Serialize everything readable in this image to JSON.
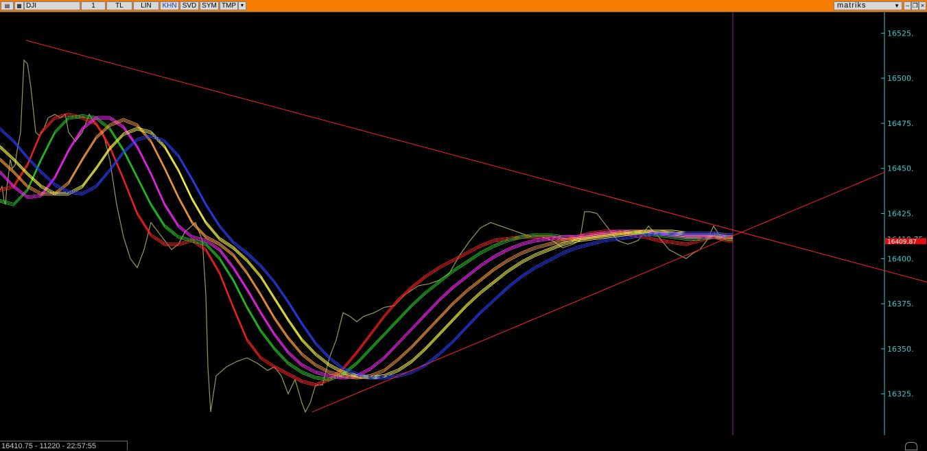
{
  "toolbar": {
    "symbol": "DJI",
    "period": "1",
    "buttons": [
      "TL",
      "LIN",
      "KHN",
      "SVD",
      "SYM",
      "TMP"
    ],
    "active_button": "KHN",
    "dropdown_icon": "triangle-down-icon",
    "brand": "matriks",
    "window_icons": [
      "minimize-icon",
      "restore-icon",
      "close-icon"
    ]
  },
  "colors": {
    "toolbar_bg": "#f57c00",
    "background": "#000000",
    "price": "#9a9a5a",
    "axis_labels": "#3ec8c8",
    "trendline": "#ff2020",
    "current_price_tag": "#e01010"
  },
  "chart_data": {
    "type": "line",
    "symbol": "DJI",
    "y_ticks": [
      16525,
      16500,
      16475,
      16450,
      16425,
      16400,
      16375,
      16350,
      16325
    ],
    "ylim": [
      16304,
      16535
    ],
    "last_price_label": "16410.75",
    "indicator_label": "16409.87",
    "series": [
      {
        "color": "#9a9a5a",
        "x": [
          0,
          3,
          6,
          8,
          10,
          12,
          15,
          18,
          22,
          25,
          30,
          35,
          40,
          45,
          52,
          58,
          64,
          70,
          80,
          88,
          95,
          100,
          110,
          120,
          130,
          140,
          150,
          160,
          170,
          180,
          190,
          200,
          210,
          220,
          230,
          240,
          250,
          260,
          270,
          285,
          295,
          300,
          303,
          307,
          315,
          330,
          345,
          360,
          375,
          390,
          400,
          410,
          420,
          430,
          440,
          445,
          452,
          460,
          470,
          480,
          490,
          500,
          510,
          520,
          530,
          545,
          560,
          575,
          590,
          610,
          625,
          640,
          655,
          670,
          685,
          700,
          715,
          730,
          745,
          760,
          775,
          790,
          805,
          820,
          835,
          845,
          852,
          860,
          870,
          880,
          890,
          900,
          915,
          930,
          945,
          960,
          975,
          990,
          1000,
          1010,
          1020,
          1030,
          1040,
          1050,
          1060,
          1068
        ],
        "y": [
          16438,
          16440,
          16432,
          16430,
          16440,
          16445,
          16455,
          16450,
          16452,
          16460,
          16470,
          16510,
          16508,
          16495,
          16470,
          16468,
          16472,
          16478,
          16480,
          16478,
          16480,
          16470,
          16465,
          16470,
          16480,
          16474,
          16470,
          16455,
          16430,
          16412,
          16400,
          16395,
          16405,
          16420,
          16415,
          16410,
          16405,
          16408,
          16415,
          16420,
          16410,
          16380,
          16340,
          16315,
          16335,
          16340,
          16343,
          16345,
          16342,
          16338,
          16340,
          16335,
          16325,
          16333,
          16320,
          16315,
          16320,
          16330,
          16330,
          16345,
          16355,
          16370,
          16368,
          16365,
          16368,
          16370,
          16373,
          16374,
          16380,
          16385,
          16386,
          16388,
          16392,
          16402,
          16410,
          16417,
          16420,
          16418,
          16416,
          16414,
          16412,
          16412,
          16410,
          16406,
          16408,
          16410,
          16426,
          16426,
          16425,
          16420,
          16415,
          16410,
          16408,
          16410,
          16418,
          16412,
          16405,
          16402,
          16400,
          16403,
          16405,
          16410,
          16418,
          16412,
          16410,
          16410
        ]
      },
      {
        "color": "#ff2020",
        "x": [
          0,
          20,
          40,
          60,
          80,
          100,
          120,
          140,
          160,
          180,
          200,
          220,
          240,
          260,
          280,
          300,
          320,
          340,
          360,
          380,
          400,
          420,
          440,
          460,
          480,
          500,
          520,
          540,
          560,
          580,
          600,
          620,
          640,
          660,
          680,
          700,
          720,
          740,
          760,
          780,
          800,
          820,
          840,
          860,
          880,
          900,
          920,
          940,
          960,
          980,
          1000,
          1020,
          1040,
          1060,
          1068
        ],
        "y": [
          16438,
          16440,
          16452,
          16470,
          16478,
          16480,
          16478,
          16475,
          16462,
          16444,
          16425,
          16413,
          16408,
          16408,
          16410,
          16405,
          16392,
          16373,
          16355,
          16345,
          16340,
          16336,
          16332,
          16330,
          16333,
          16339,
          16348,
          16358,
          16368,
          16377,
          16384,
          16390,
          16395,
          16399,
          16403,
          16407,
          16410,
          16411,
          16412,
          16412,
          16412,
          16411,
          16412,
          16414,
          16415,
          16415,
          16413,
          16412,
          16410,
          16409,
          16408,
          16410,
          16412,
          16410,
          16410
        ]
      },
      {
        "color": "#22cc22",
        "x": [
          0,
          20,
          40,
          60,
          80,
          100,
          120,
          140,
          160,
          180,
          200,
          220,
          240,
          260,
          280,
          300,
          320,
          340,
          360,
          380,
          400,
          420,
          440,
          460,
          480,
          500,
          520,
          540,
          560,
          580,
          600,
          620,
          640,
          660,
          680,
          700,
          720,
          740,
          760,
          780,
          800,
          820,
          840,
          860,
          880,
          900,
          920,
          940,
          960,
          980,
          1000,
          1020,
          1040,
          1060,
          1068
        ],
        "y": [
          16432,
          16430,
          16438,
          16455,
          16470,
          16478,
          16479,
          16478,
          16472,
          16460,
          16445,
          16430,
          16418,
          16412,
          16410,
          16408,
          16400,
          16388,
          16373,
          16360,
          16350,
          16342,
          16337,
          16334,
          16333,
          16336,
          16342,
          16350,
          16358,
          16366,
          16374,
          16381,
          16387,
          16393,
          16398,
          16403,
          16407,
          16410,
          16412,
          16413,
          16413,
          16412,
          16412,
          16413,
          16414,
          16415,
          16415,
          16414,
          16413,
          16412,
          16411,
          16411,
          16412,
          16411,
          16411
        ]
      },
      {
        "color": "#ff22ff",
        "x": [
          0,
          20,
          40,
          60,
          80,
          100,
          120,
          140,
          160,
          180,
          200,
          220,
          240,
          260,
          280,
          300,
          320,
          340,
          360,
          380,
          400,
          420,
          440,
          460,
          480,
          500,
          520,
          540,
          560,
          580,
          600,
          620,
          640,
          660,
          680,
          700,
          720,
          740,
          760,
          780,
          800,
          820,
          840,
          860,
          880,
          900,
          920,
          940,
          960,
          980,
          1000,
          1020,
          1040,
          1060,
          1068
        ],
        "y": [
          16448,
          16440,
          16434,
          16435,
          16445,
          16460,
          16472,
          16478,
          16478,
          16473,
          16462,
          16447,
          16430,
          16418,
          16412,
          16410,
          16405,
          16395,
          16383,
          16370,
          16358,
          16348,
          16341,
          16337,
          16335,
          16334,
          16335,
          16339,
          16345,
          16353,
          16361,
          16369,
          16377,
          16384,
          16390,
          16396,
          16401,
          16405,
          16408,
          16410,
          16411,
          16412,
          16412,
          16413,
          16414,
          16415,
          16415,
          16415,
          16414,
          16413,
          16412,
          16412,
          16412,
          16412,
          16412
        ]
      },
      {
        "color": "#ffa040",
        "x": [
          0,
          20,
          40,
          60,
          80,
          100,
          120,
          140,
          160,
          180,
          200,
          220,
          240,
          260,
          280,
          300,
          320,
          340,
          360,
          380,
          400,
          420,
          440,
          460,
          480,
          500,
          520,
          540,
          560,
          580,
          600,
          620,
          640,
          660,
          680,
          700,
          720,
          740,
          760,
          780,
          800,
          820,
          840,
          860,
          880,
          900,
          920,
          940,
          960,
          980,
          1000,
          1020,
          1040,
          1060,
          1068
        ],
        "y": [
          16455,
          16448,
          16440,
          16436,
          16436,
          16442,
          16455,
          16467,
          16474,
          16477,
          16474,
          16465,
          16450,
          16434,
          16420,
          16412,
          16408,
          16402,
          16392,
          16380,
          16367,
          16356,
          16347,
          16341,
          16337,
          16335,
          16334,
          16335,
          16338,
          16344,
          16351,
          16359,
          16367,
          16375,
          16382,
          16388,
          16394,
          16399,
          16403,
          16406,
          16408,
          16410,
          16411,
          16412,
          16413,
          16414,
          16415,
          16415,
          16415,
          16414,
          16413,
          16413,
          16413,
          16412,
          16412
        ]
      },
      {
        "color": "#ffff40",
        "x": [
          0,
          20,
          40,
          60,
          80,
          100,
          120,
          140,
          160,
          180,
          200,
          220,
          240,
          260,
          280,
          300,
          320,
          340,
          360,
          380,
          400,
          420,
          440,
          460,
          480,
          500,
          520,
          540,
          560,
          580,
          600,
          620,
          640,
          660,
          680,
          700,
          720,
          740,
          760,
          780,
          800,
          820,
          840,
          860,
          880,
          900,
          920,
          940,
          960,
          980,
          1000,
          1020,
          1040,
          1060,
          1068
        ],
        "y": [
          16462,
          16455,
          16447,
          16440,
          16436,
          16436,
          16440,
          16450,
          16461,
          16469,
          16472,
          16470,
          16462,
          16449,
          16433,
          16420,
          16411,
          16406,
          16399,
          16390,
          16378,
          16366,
          16355,
          16347,
          16341,
          16337,
          16335,
          16334,
          16335,
          16338,
          16343,
          16350,
          16358,
          16366,
          16374,
          16381,
          16387,
          16393,
          16398,
          16402,
          16405,
          16408,
          16410,
          16411,
          16412,
          16413,
          16414,
          16415,
          16415,
          16415,
          16414,
          16414,
          16414,
          16413,
          16413
        ]
      },
      {
        "color": "#2a40ff",
        "x": [
          0,
          20,
          40,
          60,
          80,
          100,
          120,
          140,
          160,
          180,
          200,
          220,
          240,
          260,
          280,
          300,
          320,
          340,
          360,
          380,
          400,
          420,
          440,
          460,
          480,
          500,
          520,
          540,
          560,
          580,
          600,
          620,
          640,
          660,
          680,
          700,
          720,
          740,
          760,
          780,
          800,
          820,
          840,
          860,
          880,
          900,
          920,
          940,
          960,
          980,
          1000,
          1020,
          1040,
          1060,
          1068
        ],
        "y": [
          16472,
          16465,
          16456,
          16448,
          16441,
          16437,
          16436,
          16440,
          16449,
          16459,
          16466,
          16468,
          16465,
          16457,
          16444,
          16430,
          16418,
          16409,
          16403,
          16396,
          16387,
          16376,
          16364,
          16353,
          16345,
          16339,
          16336,
          16334,
          16334,
          16335,
          16337,
          16341,
          16347,
          16354,
          16362,
          16370,
          16377,
          16384,
          16390,
          16395,
          16399,
          16403,
          16406,
          16408,
          16410,
          16411,
          16412,
          16413,
          16414,
          16414,
          16414,
          16414,
          16414,
          16413,
          16413
        ]
      }
    ],
    "trendlines": [
      {
        "color": "#ff2020",
        "x": [
          38,
          1351
        ],
        "y": [
          16521,
          16387
        ]
      },
      {
        "color": "#ff2020",
        "x": [
          455,
          1290
        ],
        "y": [
          16315,
          16448
        ]
      }
    ],
    "x_extent": [
      0,
      1289
    ],
    "cursor_line_x": 1068
  },
  "status": "16410.75 - 11220 - 22:57:55"
}
